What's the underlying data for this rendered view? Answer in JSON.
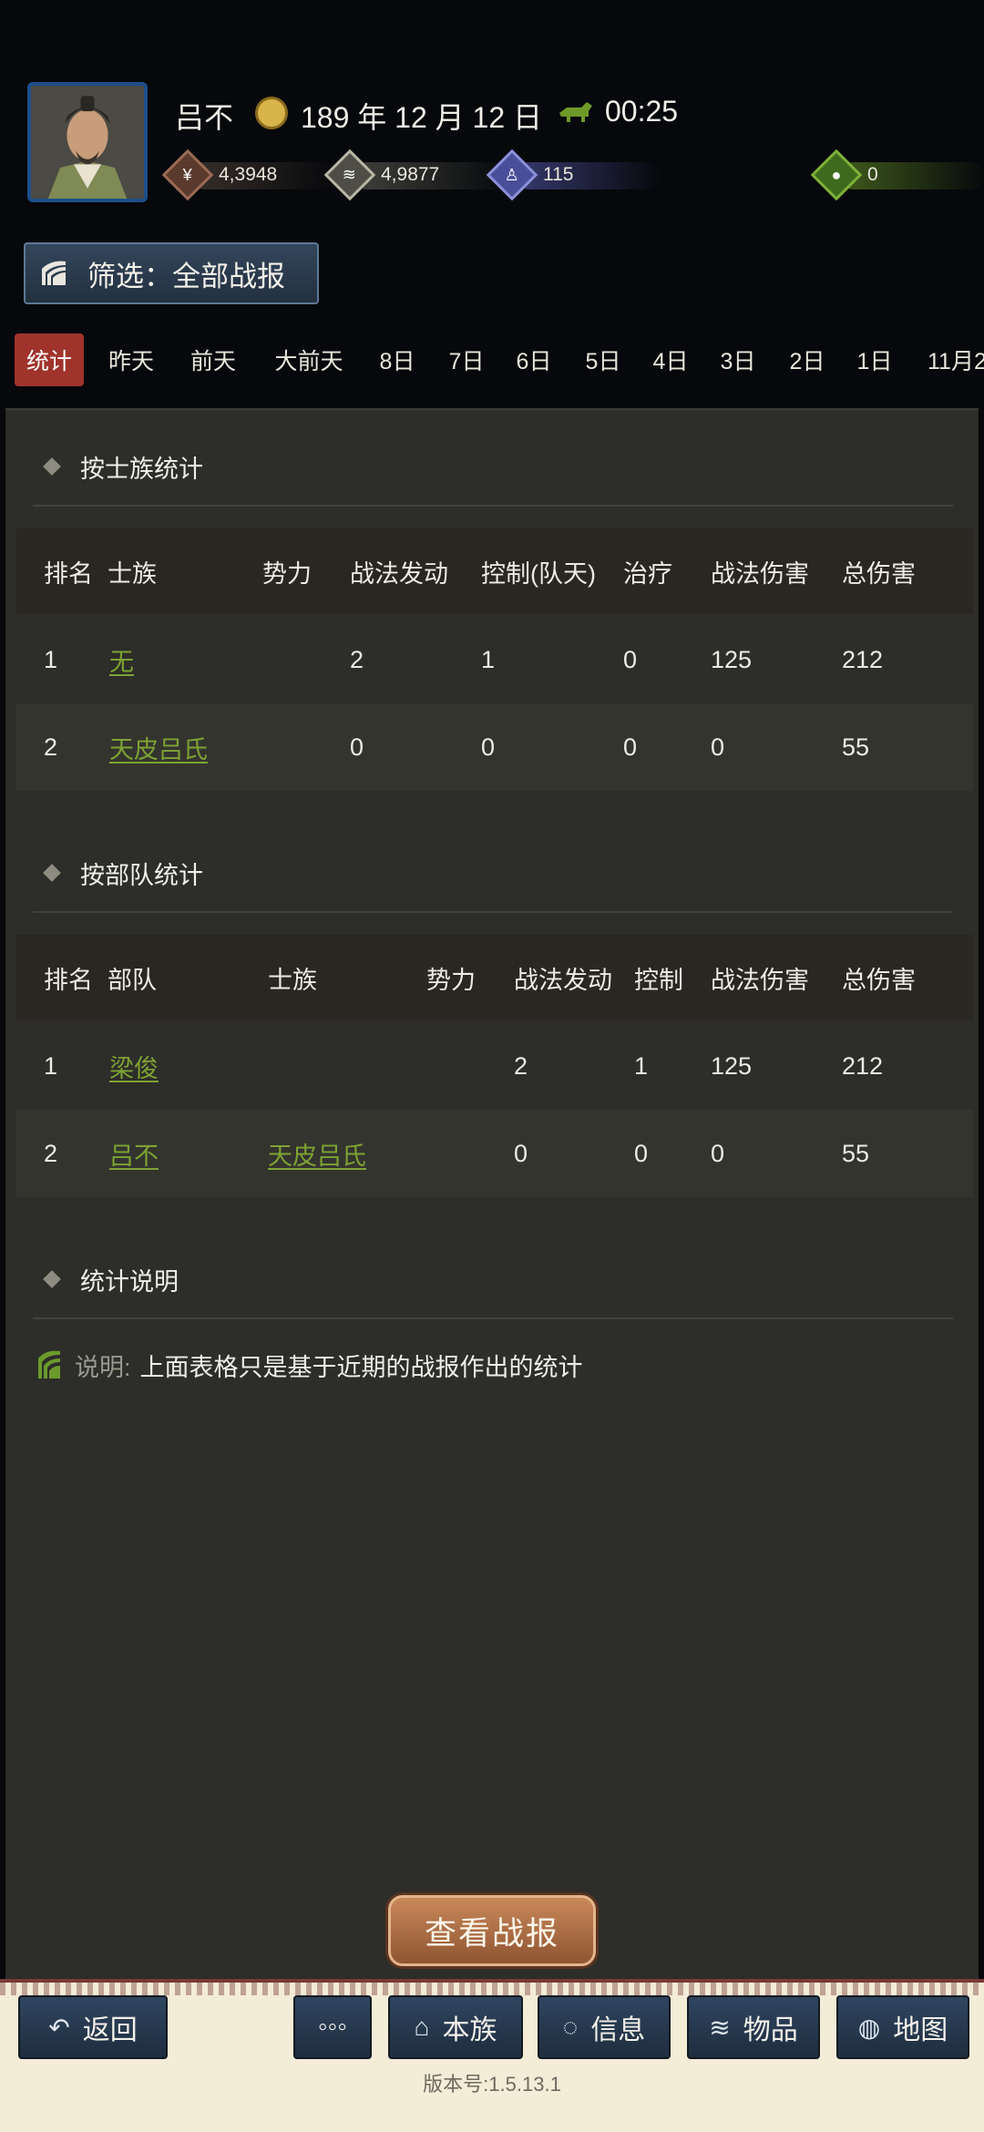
{
  "header": {
    "player_name": "吕不",
    "date": "189 年 12 月 12 日",
    "time": "00:25",
    "resources": {
      "copper": "4,3948",
      "iron": "4,9877",
      "troops": "115",
      "gold": "0"
    },
    "filter_label": "筛选：全部战报"
  },
  "tabs": [
    "统计",
    "昨天",
    "前天",
    "大前天",
    "8日",
    "7日",
    "6日",
    "5日",
    "4日",
    "3日",
    "2日",
    "1日",
    "11月2"
  ],
  "clan_stats": {
    "title": "按士族统计",
    "columns": [
      "排名",
      "士族",
      "势力",
      "战法发动",
      "控制(队天)",
      "治疗",
      "战法伤害",
      "总伤害"
    ],
    "rows": [
      {
        "rank": "1",
        "clan": "无",
        "power": "",
        "skill_triggers": "2",
        "control": "1",
        "heal": "0",
        "skill_damage": "125",
        "total_damage": "212"
      },
      {
        "rank": "2",
        "clan": "天皮吕氏",
        "power": "",
        "skill_triggers": "0",
        "control": "0",
        "heal": "0",
        "skill_damage": "0",
        "total_damage": "55"
      }
    ]
  },
  "troop_stats": {
    "title": "按部队统计",
    "columns": [
      "排名",
      "部队",
      "士族",
      "势力",
      "战法发动",
      "控制",
      "战法伤害",
      "总伤害"
    ],
    "rows": [
      {
        "rank": "1",
        "troop": "梁俊",
        "clan": "",
        "power": "",
        "skill_triggers": "2",
        "control": "1",
        "skill_damage": "125",
        "total_damage": "212"
      },
      {
        "rank": "2",
        "troop": "吕不",
        "clan": "天皮吕氏",
        "power": "",
        "skill_triggers": "0",
        "control": "0",
        "skill_damage": "0",
        "total_damage": "55"
      }
    ]
  },
  "notes": {
    "title": "统计说明",
    "label": "说明:",
    "text": "上面表格只是基于近期的战报作出的统计"
  },
  "view_reports_button": "查看战报",
  "bottom_nav": {
    "back": "返回",
    "more": "◦◦◦",
    "clan": "本族",
    "messages": "信息",
    "items": "物品",
    "map": "地图"
  },
  "version": "版本号:1.5.13.1",
  "colors": {
    "link": "#7ea333",
    "active_tab": "#a0332c",
    "panel_bg": "#2d2d29",
    "button_blue": "#2f4560"
  }
}
